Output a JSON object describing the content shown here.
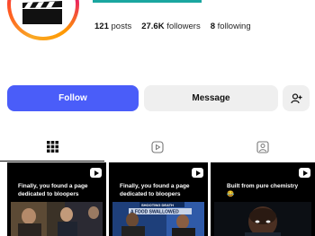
{
  "profile": {
    "stats": {
      "posts_count": "121",
      "posts_label": "posts",
      "followers_count": "27.6K",
      "followers_label": "followers",
      "following_count": "8",
      "following_label": "following"
    }
  },
  "actions": {
    "follow_label": "Follow",
    "message_label": "Message"
  },
  "tabs": [
    {
      "icon": "grid-icon",
      "active": true
    },
    {
      "icon": "reels-icon",
      "active": false
    },
    {
      "icon": "tagged-icon",
      "active": false
    }
  ],
  "posts": [
    {
      "caption": "Finally, you found a page dedicated to bloopers",
      "icon": "play-icon"
    },
    {
      "caption": "Finally, you found a page dedicated to bloopers",
      "icon": "play-icon",
      "overlay_text_1": "SHOOTING DEATH",
      "overlay_text_2": "A FOOD SWALLOWED"
    },
    {
      "caption": "Built from pure chemistry 😂",
      "icon": "play-icon"
    }
  ],
  "colors": {
    "follow_bg": "#4a5df9",
    "secondary_bg": "#efefef",
    "accent_teal": "#1aa6a0"
  }
}
